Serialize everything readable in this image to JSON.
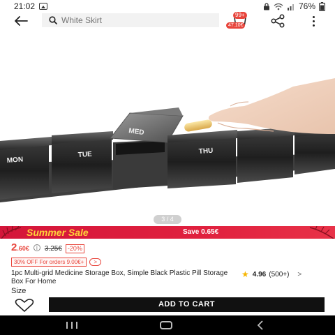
{
  "status_bar": {
    "time": "21:02",
    "battery": "76%",
    "icons": [
      "image-icon",
      "lock-icon",
      "wifi-icon",
      "signal-icon",
      "battery-icon"
    ]
  },
  "header": {
    "search_placeholder": "White Skirt",
    "cart_badge": "99+",
    "cart_amount": "47.10€",
    "icons": [
      "back-arrow-icon",
      "search-icon",
      "cart-icon",
      "share-icon",
      "more-icon"
    ]
  },
  "gallery": {
    "indicator": "3 / 4",
    "day_labels": [
      "MON",
      "TUE",
      "MED",
      "THU"
    ]
  },
  "banner": {
    "title": "Summer Sale",
    "save_text": "Save 0.65€"
  },
  "price": {
    "current_main": "2",
    "current_rest": ".60€",
    "info_symbol": "i",
    "original": "3.25€",
    "discount": "-20%"
  },
  "coupon": {
    "text": "30% OFF For orders 9.00€+",
    "arrow": ">"
  },
  "product": {
    "title": "1pc Multi-grid Medicine Storage Box, Simple Black Plastic Pill Storage Box For Home",
    "rating": "4.96",
    "reviews": "(500+)",
    "chevron": ">"
  },
  "size": {
    "label": "Size"
  },
  "actions": {
    "add_to_cart": "ADD TO CART"
  },
  "colors": {
    "accent": "#e8453c",
    "banner_red": "#d4163a",
    "banner_yellow": "#ffd23a",
    "cta_black": "#111111",
    "star": "#f7b500"
  }
}
